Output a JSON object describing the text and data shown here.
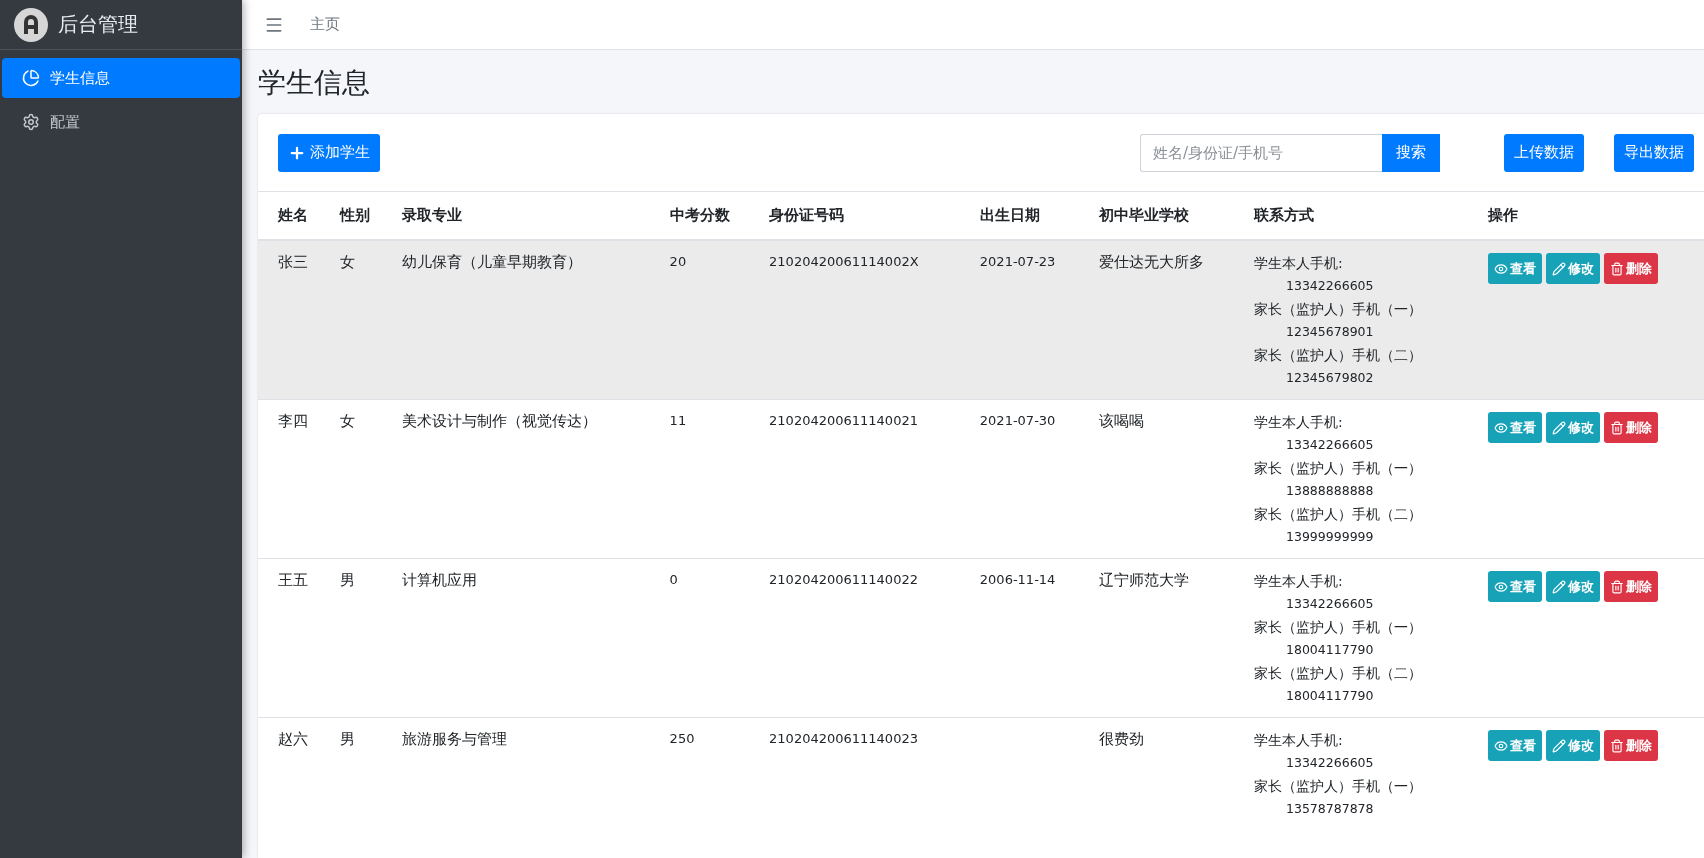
{
  "brand": {
    "title": "后台管理"
  },
  "sidebar": {
    "items": [
      {
        "label": "学生信息",
        "kind": "chart",
        "selected": true
      },
      {
        "label": "配置",
        "kind": "gear",
        "selected": false
      }
    ]
  },
  "topbar": {
    "breadcrumb": "主页"
  },
  "page": {
    "title": "学生信息"
  },
  "toolbar": {
    "add_button": "添加学生",
    "search": {
      "placeholder": "姓名/身份证/手机号",
      "button": "搜索"
    },
    "buttons": [
      "上传数据",
      "导出数据"
    ]
  },
  "table": {
    "columns": [
      "姓名",
      "性别",
      "录取专业",
      "中考分数",
      "身份证号码",
      "出生日期",
      "初中毕业学校",
      "联系方式",
      "操作"
    ],
    "rows": [
      {
        "selected": true,
        "cells": [
          "张三",
          "女",
          "幼儿保育（儿童早期教育）",
          "20",
          "21020420061114002X",
          "2021-07-23",
          "爱仕达无大所多"
        ],
        "contacts": [
          {
            "label": "学生本人手机:",
            "phone": "13342266605"
          },
          {
            "label": "家长（监护人）手机（一）",
            "phone": "12345678901"
          },
          {
            "label": "家长（监护人）手机（二）",
            "phone": "12345679802"
          }
        ],
        "actions": [
          {
            "kind": "view",
            "label": "查看"
          },
          {
            "kind": "edit",
            "label": "修改"
          },
          {
            "kind": "delete",
            "label": "删除"
          }
        ]
      },
      {
        "selected": false,
        "cells": [
          "李四",
          "女",
          "美术设计与制作（视觉传达）",
          "11",
          "210204200611140021",
          "2021-07-30",
          "该喝喝"
        ],
        "contacts": [
          {
            "label": "学生本人手机:",
            "phone": "13342266605"
          },
          {
            "label": "家长（监护人）手机（一）",
            "phone": "13888888888"
          },
          {
            "label": "家长（监护人）手机（二）",
            "phone": "13999999999"
          }
        ],
        "actions": [
          {
            "kind": "view",
            "label": "查看"
          },
          {
            "kind": "edit",
            "label": "修改"
          },
          {
            "kind": "delete",
            "label": "删除"
          }
        ]
      },
      {
        "selected": false,
        "cells": [
          "王五",
          "男",
          "计算机应用",
          "0",
          "210204200611140022",
          "2006-11-14",
          "辽宁师范大学"
        ],
        "contacts": [
          {
            "label": "学生本人手机:",
            "phone": "13342266605"
          },
          {
            "label": "家长（监护人）手机（一）",
            "phone": "18004117790"
          },
          {
            "label": "家长（监护人）手机（二）",
            "phone": "18004117790"
          }
        ],
        "actions": [
          {
            "kind": "view",
            "label": "查看"
          },
          {
            "kind": "edit",
            "label": "修改"
          },
          {
            "kind": "delete",
            "label": "删除"
          }
        ]
      },
      {
        "selected": false,
        "cells": [
          "赵六",
          "男",
          "旅游服务与管理",
          "250",
          "210204200611140023",
          "",
          "很费劲"
        ],
        "contacts": [
          {
            "label": "学生本人手机:",
            "phone": "13342266605"
          },
          {
            "label": "家长（监护人）手机（一）",
            "phone": "13578787878"
          }
        ],
        "actions": [
          {
            "kind": "view",
            "label": "查看"
          },
          {
            "kind": "edit",
            "label": "修改"
          },
          {
            "kind": "delete",
            "label": "删除"
          }
        ]
      }
    ]
  }
}
